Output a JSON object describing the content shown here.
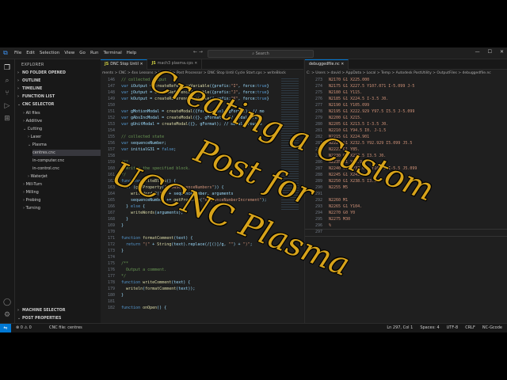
{
  "titlebar": {
    "menus": [
      "File",
      "Edit",
      "Selection",
      "View",
      "Go",
      "Run",
      "Terminal",
      "Help"
    ],
    "search": "Search"
  },
  "sidebar": {
    "title": "EXPLORER",
    "sections": [
      "NO FOLDER OPENED",
      "OUTLINE",
      "TIMELINE",
      "FUNCTION LIST",
      "CNC SELECTOR"
    ],
    "tree": [
      "All files",
      "Additive",
      "Cutting",
      "Laser",
      "Plasma",
      "centres.cnc",
      "in-computer.cnc",
      "in-control.cnc",
      "Waterjet",
      "Mill-Turn",
      "Milling",
      "Probing",
      "Turning"
    ],
    "bottom_sections": [
      "MACHINE SELECTOR",
      "POST PROPERTIES"
    ]
  },
  "editor1": {
    "tabs": [
      "DNC Stop Until",
      "mach3 plasma.cps"
    ],
    "breadcrumb": "ments > CNC > 4xx Lessons > UCCNC > Post Processor > DNC Stop Until Cycle Start.cps > writeBlock",
    "lines": [
      {
        "n": "146",
        "t": "// collected output"
      },
      {
        "n": "147",
        "t": "var iOutput = createReferenceVariable({prefix:\"I\", force:true}"
      },
      {
        "n": "148",
        "t": "var jOutput = createReferenceVariable({prefix:\"J\", force:true}"
      },
      {
        "n": "149",
        "t": "var kOutput = createReferenceVariable({prefix:\"K\", force:true}"
      },
      {
        "n": "150",
        "t": ""
      },
      {
        "n": "151",
        "t": "var gMotionModal = createModal({force:true}, gFormat); // mo"
      },
      {
        "n": "152",
        "t": "var gAbsIncModal = createModal({}, gFormat); // modal group"
      },
      {
        "n": "153",
        "t": "var gUnitModal = createModal({}, gFormat); // modal group 6"
      },
      {
        "n": "154",
        "t": ""
      },
      {
        "n": "155",
        "t": "// collected state"
      },
      {
        "n": "156",
        "t": "var sequenceNumber;"
      },
      {
        "n": "157",
        "t": "var initialG31 = false;"
      },
      {
        "n": "158",
        "t": ""
      },
      {
        "n": "159",
        "t": "/**"
      },
      {
        "n": "160",
        "t": "  Writes the specified block."
      },
      {
        "n": "161",
        "t": "*/"
      },
      {
        "n": "162",
        "t": "function writeBlock() {"
      },
      {
        "n": "163",
        "t": "  if (getProperty(\"showSequenceNumbers\")) {"
      },
      {
        "n": "164",
        "t": "    writeWords2(\"N\" + sequenceNumber, arguments"
      },
      {
        "n": "165",
        "t": "    sequenceNumber += getProperty(\"sequenceNumberIncrement\");"
      },
      {
        "n": "166",
        "t": "  } else {"
      },
      {
        "n": "167",
        "t": "    writeWords(arguments);"
      },
      {
        "n": "168",
        "t": "  }"
      },
      {
        "n": "169",
        "t": "}"
      },
      {
        "n": "170",
        "t": ""
      },
      {
        "n": "171",
        "t": "function formatComment(text) {"
      },
      {
        "n": "172",
        "t": "  return \"(\" + String(text).replace(/[()]/g, \"\") + \")\";"
      },
      {
        "n": "173",
        "t": "}"
      },
      {
        "n": "174",
        "t": ""
      },
      {
        "n": "175",
        "t": "/**"
      },
      {
        "n": "176",
        "t": "  Output a comment."
      },
      {
        "n": "177",
        "t": "*/"
      },
      {
        "n": "178",
        "t": "function writeComment(text) {"
      },
      {
        "n": "179",
        "t": "  writeln(formatComment(text));"
      },
      {
        "n": "180",
        "t": "}"
      },
      {
        "n": "181",
        "t": ""
      },
      {
        "n": "182",
        "t": "function onOpen() {"
      }
    ]
  },
  "editor2": {
    "tab": "debuggedfile.nc",
    "breadcrumb": "C: > Users > david > AppData > Local > Temp > Autodesk PostUtility > OutputFiles > debuggedfile.nc",
    "lines": [
      {
        "n": "273",
        "t": "N2170 G1 X225.000"
      },
      {
        "n": "274",
        "t": "N2175 G1 X227.5 Y107.071 I-5.099 J-5"
      },
      {
        "n": "275",
        "t": "N2180 G1 Y115."
      },
      {
        "n": "276",
        "t": "N2185 G1 X224.5 I-3.5 J0."
      },
      {
        "n": "277",
        "t": "N2190 G1 Y105.099"
      },
      {
        "n": "278",
        "t": "N2195 G1 X222.929 Y97.5 I5.5 J-5.099"
      },
      {
        "n": "279",
        "t": "N2200 G1 X215."
      },
      {
        "n": "280",
        "t": "N2205 G1 X213.5 I-3.5 J0."
      },
      {
        "n": "281",
        "t": "N2210 G1 Y94.5 I0. J-1.5"
      },
      {
        "n": "282",
        "t": "N2215 G1 X224.901"
      },
      {
        "n": "283",
        "t": "N2220 G1 X232.5 Y92.929 I5.099 J5.5"
      },
      {
        "n": "284",
        "t": "N2225 G1 Y85."
      },
      {
        "n": "285",
        "t": "N2230 G1 X233.5 I3.5 J0."
      },
      {
        "n": "286",
        "t": "N2235 G1 Y94.901"
      },
      {
        "n": "287",
        "t": "N2240 G1 X237.071 Y102.5 I-5.5 J5.099"
      },
      {
        "n": "288",
        "t": "N2245 G1 X245."
      },
      {
        "n": "289",
        "t": "N2250 G1 X238.5 I3.5"
      },
      {
        "n": "290",
        "t": "N2255 M5"
      },
      {
        "n": "291",
        "t": ""
      },
      {
        "n": "292",
        "t": "N2260 M1"
      },
      {
        "n": "293",
        "t": "N2265 G1 Y104."
      },
      {
        "n": "294",
        "t": "N2270 G0 Y0"
      },
      {
        "n": "295",
        "t": "N2275 M30"
      },
      {
        "n": "296",
        "t": "%"
      },
      {
        "n": "297",
        "t": ""
      }
    ]
  },
  "statusbar": {
    "errors": "⊗ 0 ⚠ 0",
    "file": "CNC file: centres",
    "right": [
      "Ln 297, Col 1",
      "Spaces: 4",
      "UTF-8",
      "CRLF",
      "NC-Gcode"
    ]
  },
  "overlay": {
    "line1": "Creating a Custom",
    "line2": "Post for",
    "line3": "UCCNC Plasma"
  },
  "colors": {
    "overlay_text": "#d7a31a",
    "accent": "#0078d4"
  }
}
